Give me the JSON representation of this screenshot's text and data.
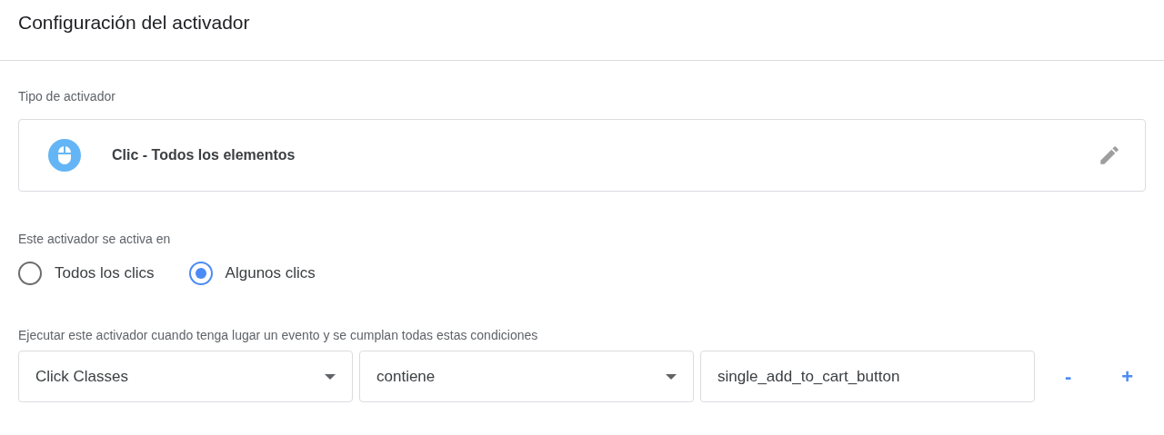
{
  "title": "Configuración del activador",
  "trigger_type": {
    "label": "Tipo de activador",
    "name": "Clic - Todos los elementos"
  },
  "fires_on": {
    "label": "Este activador se activa en",
    "options": [
      {
        "label": "Todos los clics",
        "selected": false
      },
      {
        "label": "Algunos clics",
        "selected": true
      }
    ]
  },
  "conditions": {
    "label": "Ejecutar este activador cuando tenga lugar un evento y se cumplan todas estas condiciones",
    "rows": [
      {
        "variable": "Click Classes",
        "operator": "contiene",
        "value": "single_add_to_cart_button",
        "remove": "-",
        "add": "+"
      }
    ]
  }
}
